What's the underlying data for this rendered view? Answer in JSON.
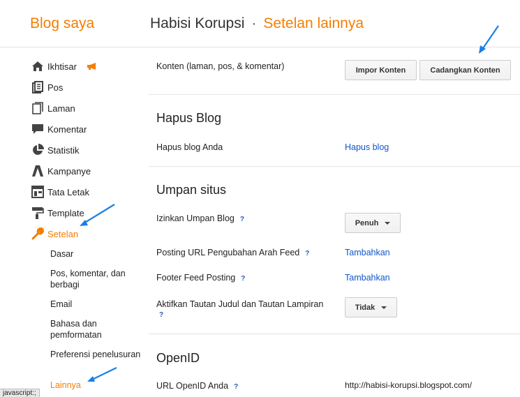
{
  "header": {
    "brand": "Blog saya",
    "blog_name": "Habisi Korupsi",
    "separator": "·",
    "page_name": "Setelan lainnya"
  },
  "sidebar": {
    "items": [
      {
        "label": "Ikhtisar",
        "icon": "home-icon"
      },
      {
        "label": "Pos",
        "icon": "posts-icon"
      },
      {
        "label": "Laman",
        "icon": "pages-icon"
      },
      {
        "label": "Komentar",
        "icon": "comment-icon"
      },
      {
        "label": "Statistik",
        "icon": "stats-pie-icon"
      },
      {
        "label": "Kampanye",
        "icon": "adwords-icon"
      },
      {
        "label": "Tata Letak",
        "icon": "layout-icon"
      },
      {
        "label": "Template",
        "icon": "paint-roller-icon"
      },
      {
        "label": "Setelan",
        "icon": "wrench-icon"
      }
    ],
    "settings_sub": [
      "Dasar",
      "Pos, komentar, dan berbagi",
      "Email",
      "Bahasa dan pemformatan",
      "Preferensi penelusuran",
      "Lainnya"
    ]
  },
  "main": {
    "content_label": "Konten (laman, pos, & komentar)",
    "import_button": "Impor Konten",
    "backup_button": "Cadangkan Konten",
    "delete_heading": "Hapus Blog",
    "delete_label": "Hapus blog Anda",
    "delete_link": "Hapus blog",
    "feed_heading": "Umpan situs",
    "allow_feed_label": "Izinkan Umpan Blog",
    "allow_feed_value": "Penuh",
    "redirect_label": "Posting URL Pengubahan Arah Feed",
    "redirect_link": "Tambahkan",
    "footer_label": "Footer Feed Posting",
    "footer_link": "Tambahkan",
    "enclosure_label": "Aktifkan Tautan Judul dan Tautan Lampiran",
    "enclosure_value": "Tidak",
    "openid_heading": "OpenID",
    "openid_label": "URL OpenID Anda",
    "openid_url": "http://habisi-korupsi.blogspot.com/",
    "help_mark": "?"
  },
  "statusbar": {
    "text": "javascript:;"
  },
  "colors": {
    "accent": "#f57d00",
    "link": "#1155cc",
    "annotation_arrow": "#1a7fe6"
  }
}
